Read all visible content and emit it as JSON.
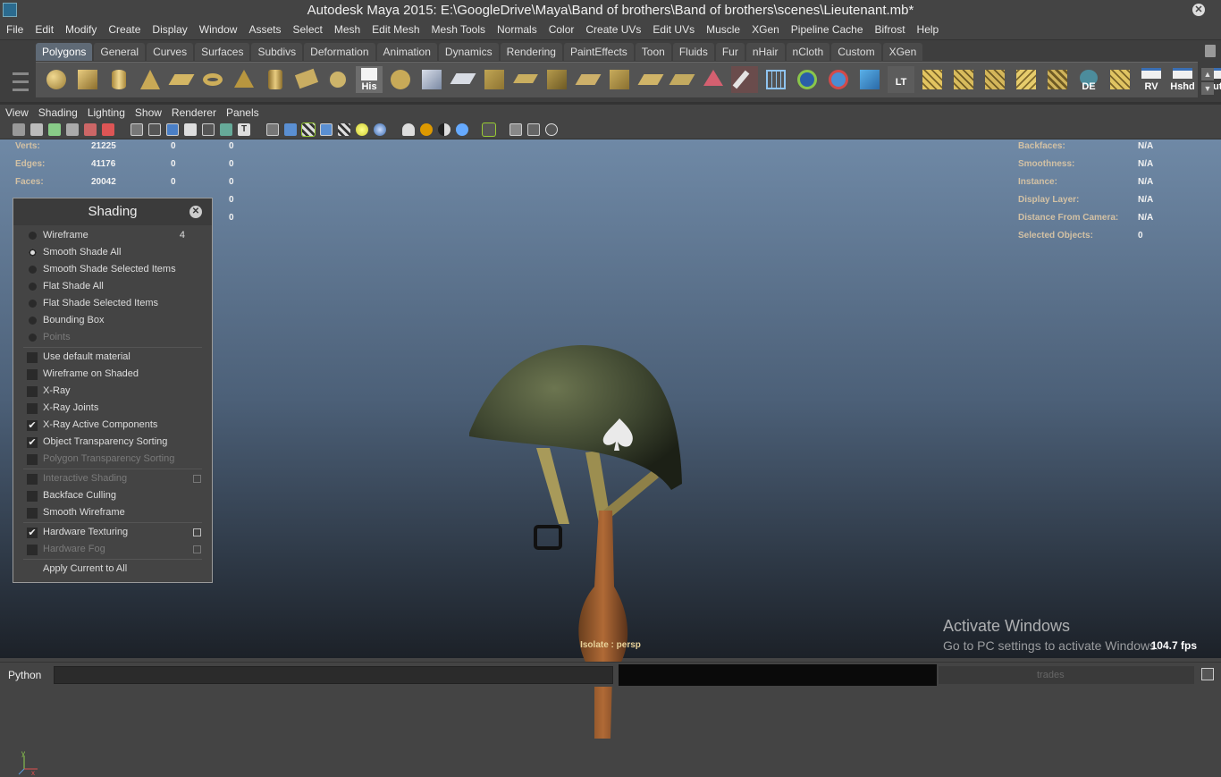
{
  "window": {
    "title": "Autodesk Maya 2015: E:\\GoogleDrive\\Maya\\Band of brothers\\Band of brothers\\scenes\\Lieutenant.mb*"
  },
  "menubar": [
    "File",
    "Edit",
    "Modify",
    "Create",
    "Display",
    "Window",
    "Assets",
    "Select",
    "Mesh",
    "Edit Mesh",
    "Mesh Tools",
    "Normals",
    "Color",
    "Create UVs",
    "Edit UVs",
    "Muscle",
    "XGen",
    "Pipeline Cache",
    "Bifrost",
    "Help"
  ],
  "shelf": {
    "tabs": [
      "Polygons",
      "General",
      "Curves",
      "Surfaces",
      "Subdivs",
      "Deformation",
      "Animation",
      "Dynamics",
      "Rendering",
      "PaintEffects",
      "Toon",
      "Fluids",
      "Fur",
      "nHair",
      "nCloth",
      "Custom",
      "XGen"
    ],
    "active_tab": "Polygons",
    "text_icons": {
      "his": "His",
      "lt": "LT",
      "de": "DE",
      "rv": "RV",
      "hshd": "Hshd",
      "out": "Out"
    }
  },
  "panel_menu": [
    "View",
    "Shading",
    "Lighting",
    "Show",
    "Renderer",
    "Panels"
  ],
  "hud_left": [
    {
      "label": "Verts:",
      "v1": "21225",
      "v2": "0",
      "v3": "0"
    },
    {
      "label": "Edges:",
      "v1": "41176",
      "v2": "0",
      "v3": "0"
    },
    {
      "label": "Faces:",
      "v1": "20042",
      "v2": "0",
      "v3": "0"
    },
    {
      "label": "",
      "v1": "",
      "v2": "",
      "v3": "0"
    },
    {
      "label": "",
      "v1": "",
      "v2": "",
      "v3": "0"
    }
  ],
  "hud_right": [
    {
      "label": "Backfaces:",
      "value": "N/A"
    },
    {
      "label": "Smoothness:",
      "value": "N/A"
    },
    {
      "label": "Instance:",
      "value": "N/A"
    },
    {
      "label": "Display Layer:",
      "value": "N/A"
    },
    {
      "label": "Distance From Camera:",
      "value": "N/A"
    },
    {
      "label": "Selected Objects:",
      "value": "0"
    }
  ],
  "shading_panel": {
    "title": "Shading",
    "radio_items": [
      {
        "label": "Wireframe",
        "hotkey": "4",
        "selected": false
      },
      {
        "label": "Smooth Shade All",
        "selected": true
      },
      {
        "label": "Smooth Shade Selected Items",
        "selected": false
      },
      {
        "label": "Flat Shade All",
        "selected": false
      },
      {
        "label": "Flat Shade Selected Items",
        "selected": false
      },
      {
        "label": "Bounding Box",
        "selected": false
      },
      {
        "label": "Points",
        "selected": false,
        "disabled": true
      }
    ],
    "check_group_1": [
      {
        "label": "Use default material",
        "checked": false
      },
      {
        "label": "Wireframe on Shaded",
        "checked": false
      },
      {
        "label": "X-Ray",
        "checked": false
      },
      {
        "label": "X-Ray Joints",
        "checked": false
      },
      {
        "label": "X-Ray Active Components",
        "checked": true
      },
      {
        "label": "Object Transparency Sorting",
        "checked": true
      },
      {
        "label": "Polygon Transparency Sorting",
        "checked": false,
        "disabled": true
      }
    ],
    "check_group_2": [
      {
        "label": "Interactive Shading",
        "checked": false,
        "disabled": true,
        "has_options": true
      },
      {
        "label": "Backface Culling",
        "checked": false
      },
      {
        "label": "Smooth Wireframe",
        "checked": false
      }
    ],
    "check_group_3": [
      {
        "label": "Hardware Texturing",
        "checked": true,
        "has_options": true
      },
      {
        "label": "Hardware Fog",
        "checked": false,
        "disabled": true,
        "has_options": true
      }
    ],
    "apply_label": "Apply Current to All"
  },
  "viewport": {
    "isolate_label": "Isolate : persp",
    "axis": {
      "y": "y",
      "x": "x"
    },
    "fps": "104.7 fps"
  },
  "watermark": {
    "line1": "Activate Windows",
    "line2": "Go to PC settings to activate Windows."
  },
  "command_line": {
    "language": "Python",
    "help_text": "trades"
  }
}
